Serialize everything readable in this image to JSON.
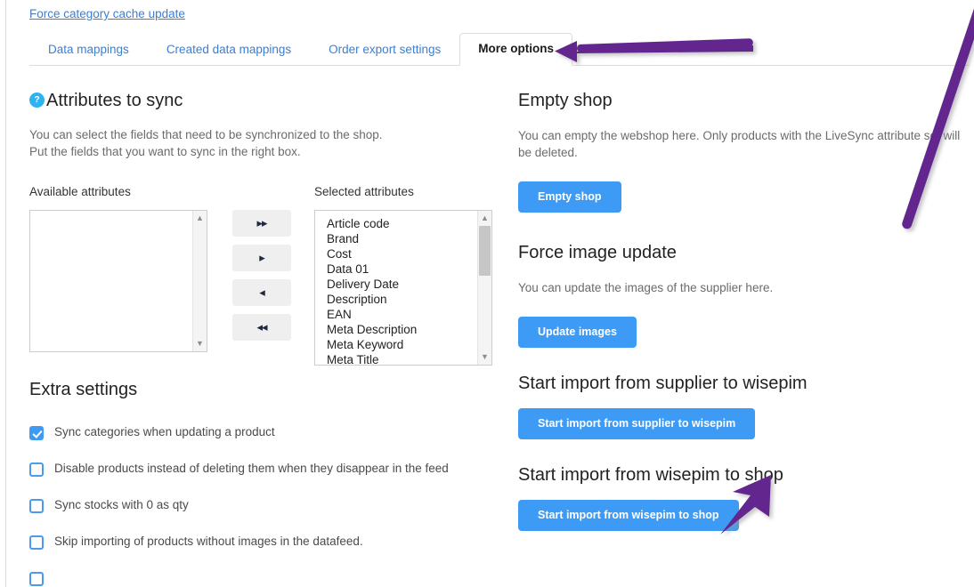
{
  "top_link": {
    "label": "Force category cache update"
  },
  "tabs": [
    {
      "label": "Data mappings",
      "active": false
    },
    {
      "label": "Created data mappings",
      "active": false
    },
    {
      "label": "Order export settings",
      "active": false
    },
    {
      "label": "More options",
      "active": true
    }
  ],
  "attributes_section": {
    "help_icon": "question-mark-icon",
    "title": "Attributes to sync",
    "description_line1": "You can select the fields that need to be synchronized to the shop.",
    "description_line2": "Put the fields that you want to sync in the right box.",
    "available_label": "Available attributes",
    "selected_label": "Selected attributes",
    "available_items": [],
    "selected_items": [
      "Article code",
      "Brand",
      "Cost",
      "Data 01",
      "Delivery Date",
      "Description",
      "EAN",
      "Meta Description",
      "Meta Keyword",
      "Meta Title"
    ],
    "transfer_buttons": [
      {
        "icon": "double-chevron-right-icon",
        "glyph": "▸▸"
      },
      {
        "icon": "chevron-right-icon",
        "glyph": "▸"
      },
      {
        "icon": "chevron-left-icon",
        "glyph": "◂"
      },
      {
        "icon": "double-chevron-left-icon",
        "glyph": "◂◂"
      }
    ]
  },
  "extra_settings": {
    "title": "Extra settings",
    "checkboxes": [
      {
        "label": "Sync categories when updating a product",
        "checked": true
      },
      {
        "label": "Disable products instead of deleting them when they disappear in the feed",
        "checked": false
      },
      {
        "label": "Sync stocks with 0 as qty",
        "checked": false
      },
      {
        "label": "Skip importing of products without images in the datafeed.",
        "checked": false
      },
      {
        "label": "",
        "checked": false
      }
    ]
  },
  "right_column": {
    "empty_shop": {
      "title": "Empty shop",
      "description": "You can empty the webshop here. Only products with the LiveSync attribute set will be deleted.",
      "button": "Empty shop"
    },
    "force_image_update": {
      "title": "Force image update",
      "description": "You can update the images of the supplier here.",
      "button": "Update images"
    },
    "import_supplier": {
      "title": "Start import from supplier to wisepim",
      "button": "Start import from supplier to wisepim"
    },
    "import_shop": {
      "title": "Start import from wisepim to shop",
      "button": "Start import from wisepim to shop"
    }
  },
  "annotations": {
    "arrow_color": "#63268f",
    "arrow_tab": "arrow-pointing-to-more-options-tab",
    "arrow_import": "arrow-pointing-to-start-import-from-wisepim-to-shop-button"
  },
  "colors": {
    "accent_blue": "#3d9bf5",
    "link_blue": "#3a7fd5",
    "help_badge": "#2fb2f2",
    "annotation_purple": "#63268f"
  }
}
